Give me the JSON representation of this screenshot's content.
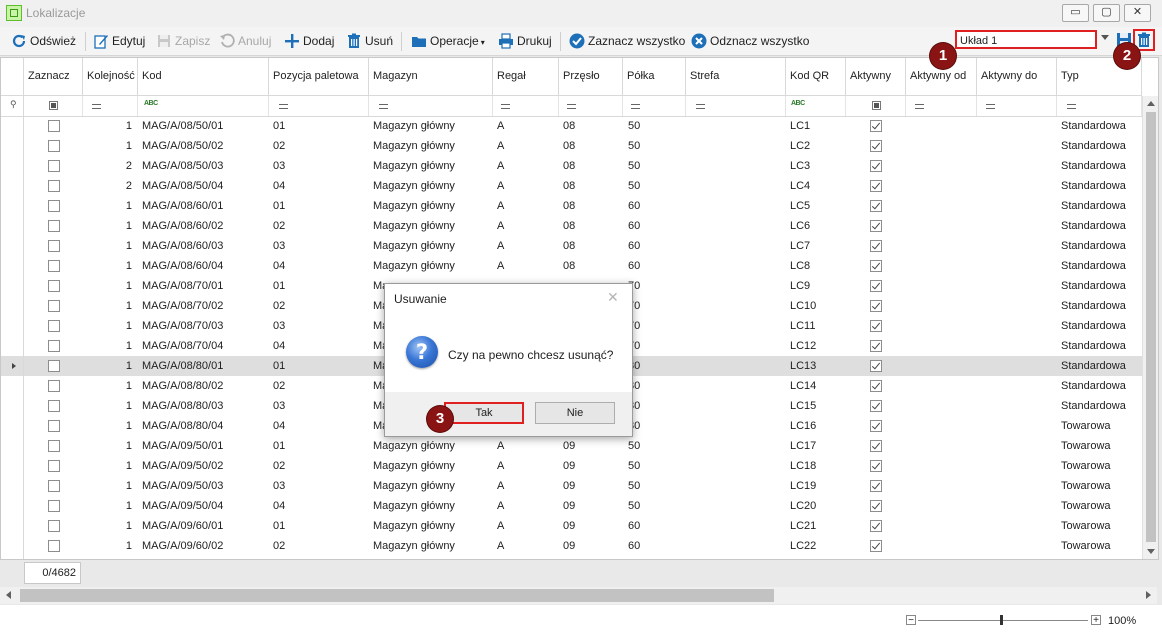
{
  "window": {
    "title": "Lokalizacje",
    "min_label": "▭",
    "max_label": "▢",
    "close_label": "✕"
  },
  "toolbar": {
    "refresh": "Odśwież",
    "edit": "Edytuj",
    "save": "Zapisz",
    "cancel": "Anuluj",
    "add": "Dodaj",
    "delete": "Usuń",
    "operations": "Operacje",
    "print": "Drukuj",
    "select_all": "Zaznacz wszystko",
    "deselect_all": "Odznacz wszystko",
    "layout_value": "Układ 1"
  },
  "badges": {
    "b1": "1",
    "b2": "2",
    "b3": "3"
  },
  "grid": {
    "headers": [
      "Zaznacz",
      "Kolejność",
      "Kod",
      "Pozycja paletowa",
      "Magazyn",
      "Regał",
      "Przęsło",
      "Półka",
      "Strefa",
      "Kod QR",
      "Aktywny",
      "Aktywny od",
      "Aktywny do",
      "Typ"
    ],
    "rows": [
      {
        "order": "1",
        "code": "MAG/A/08/50/01",
        "pos": "01",
        "wh": "Magazyn główny",
        "rack": "A",
        "span": "08",
        "shelf": "50",
        "qr": "LC1",
        "type": "Standardowa"
      },
      {
        "order": "1",
        "code": "MAG/A/08/50/02",
        "pos": "02",
        "wh": "Magazyn główny",
        "rack": "A",
        "span": "08",
        "shelf": "50",
        "qr": "LC2",
        "type": "Standardowa"
      },
      {
        "order": "2",
        "code": "MAG/A/08/50/03",
        "pos": "03",
        "wh": "Magazyn główny",
        "rack": "A",
        "span": "08",
        "shelf": "50",
        "qr": "LC3",
        "type": "Standardowa"
      },
      {
        "order": "2",
        "code": "MAG/A/08/50/04",
        "pos": "04",
        "wh": "Magazyn główny",
        "rack": "A",
        "span": "08",
        "shelf": "50",
        "qr": "LC4",
        "type": "Standardowa"
      },
      {
        "order": "1",
        "code": "MAG/A/08/60/01",
        "pos": "01",
        "wh": "Magazyn główny",
        "rack": "A",
        "span": "08",
        "shelf": "60",
        "qr": "LC5",
        "type": "Standardowa"
      },
      {
        "order": "1",
        "code": "MAG/A/08/60/02",
        "pos": "02",
        "wh": "Magazyn główny",
        "rack": "A",
        "span": "08",
        "shelf": "60",
        "qr": "LC6",
        "type": "Standardowa"
      },
      {
        "order": "1",
        "code": "MAG/A/08/60/03",
        "pos": "03",
        "wh": "Magazyn główny",
        "rack": "A",
        "span": "08",
        "shelf": "60",
        "qr": "LC7",
        "type": "Standardowa"
      },
      {
        "order": "1",
        "code": "MAG/A/08/60/04",
        "pos": "04",
        "wh": "Magazyn główny",
        "rack": "A",
        "span": "08",
        "shelf": "60",
        "qr": "LC8",
        "type": "Standardowa"
      },
      {
        "order": "1",
        "code": "MAG/A/08/70/01",
        "pos": "01",
        "wh": "Ma",
        "rack": "",
        "span": "",
        "shelf": "70",
        "qr": "LC9",
        "type": "Standardowa"
      },
      {
        "order": "1",
        "code": "MAG/A/08/70/02",
        "pos": "02",
        "wh": "Ma",
        "rack": "",
        "span": "",
        "shelf": "70",
        "qr": "LC10",
        "type": "Standardowa"
      },
      {
        "order": "1",
        "code": "MAG/A/08/70/03",
        "pos": "03",
        "wh": "Ma",
        "rack": "",
        "span": "",
        "shelf": "70",
        "qr": "LC11",
        "type": "Standardowa"
      },
      {
        "order": "1",
        "code": "MAG/A/08/70/04",
        "pos": "04",
        "wh": "Ma",
        "rack": "",
        "span": "",
        "shelf": "70",
        "qr": "LC12",
        "type": "Standardowa"
      },
      {
        "order": "1",
        "code": "MAG/A/08/80/01",
        "pos": "01",
        "wh": "Ma",
        "rack": "",
        "span": "",
        "shelf": "80",
        "qr": "LC13",
        "type": "Standardowa"
      },
      {
        "order": "1",
        "code": "MAG/A/08/80/02",
        "pos": "02",
        "wh": "Ma",
        "rack": "",
        "span": "",
        "shelf": "80",
        "qr": "LC14",
        "type": "Standardowa"
      },
      {
        "order": "1",
        "code": "MAG/A/08/80/03",
        "pos": "03",
        "wh": "Ma",
        "rack": "",
        "span": "",
        "shelf": "80",
        "qr": "LC15",
        "type": "Standardowa"
      },
      {
        "order": "1",
        "code": "MAG/A/08/80/04",
        "pos": "04",
        "wh": "Ma",
        "rack": "",
        "span": "",
        "shelf": "80",
        "qr": "LC16",
        "type": "Towarowa"
      },
      {
        "order": "1",
        "code": "MAG/A/09/50/01",
        "pos": "01",
        "wh": "Magazyn główny",
        "rack": "A",
        "span": "09",
        "shelf": "50",
        "qr": "LC17",
        "type": "Towarowa"
      },
      {
        "order": "1",
        "code": "MAG/A/09/50/02",
        "pos": "02",
        "wh": "Magazyn główny",
        "rack": "A",
        "span": "09",
        "shelf": "50",
        "qr": "LC18",
        "type": "Towarowa"
      },
      {
        "order": "1",
        "code": "MAG/A/09/50/03",
        "pos": "03",
        "wh": "Magazyn główny",
        "rack": "A",
        "span": "09",
        "shelf": "50",
        "qr": "LC19",
        "type": "Towarowa"
      },
      {
        "order": "1",
        "code": "MAG/A/09/50/04",
        "pos": "04",
        "wh": "Magazyn główny",
        "rack": "A",
        "span": "09",
        "shelf": "50",
        "qr": "LC20",
        "type": "Towarowa"
      },
      {
        "order": "1",
        "code": "MAG/A/09/60/01",
        "pos": "01",
        "wh": "Magazyn główny",
        "rack": "A",
        "span": "09",
        "shelf": "60",
        "qr": "LC21",
        "type": "Towarowa"
      },
      {
        "order": "1",
        "code": "MAG/A/09/60/02",
        "pos": "02",
        "wh": "Magazyn główny",
        "rack": "A",
        "span": "09",
        "shelf": "60",
        "qr": "LC22",
        "type": "Towarowa"
      }
    ],
    "selected_row": 12
  },
  "footer": {
    "count": "0/4682"
  },
  "zoom": {
    "minus": "−",
    "plus": "+",
    "label": "100%",
    "level": 0.49
  },
  "dialog": {
    "title": "Usuwanie",
    "close": "✕",
    "icon": "?",
    "message": "Czy na pewno chcesz usunąć?",
    "yes": "Tak",
    "no": "Nie"
  },
  "colors": {
    "accent": "#1d6fb8",
    "highlight": "#e02020",
    "badge": "#8a1414"
  }
}
